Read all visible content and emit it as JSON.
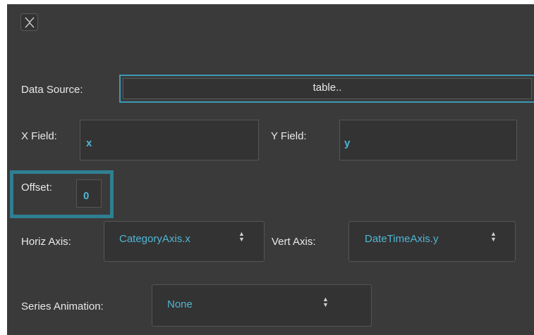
{
  "close": {
    "icon": "close-icon"
  },
  "data_source": {
    "label": "Data Source:",
    "value": "table.."
  },
  "x_field": {
    "label": "X Field:",
    "value": "x"
  },
  "y_field": {
    "label": "Y Field:",
    "value": "y"
  },
  "offset": {
    "label": "Offset:",
    "value": "0"
  },
  "horiz_axis": {
    "label": "Horiz Axis:",
    "value": "CategoryAxis.x"
  },
  "vert_axis": {
    "label": "Vert Axis:",
    "value": "DateTimeAxis.y"
  },
  "series_animation": {
    "label": "Series Animation:",
    "value": "None"
  },
  "colors": {
    "panel_bg": "#3a3a3a",
    "accent": "#4fb6d3",
    "focus_ring": "#3a9bb3",
    "highlight_frame": "#2f7f92",
    "text": "#e9e9e9"
  }
}
